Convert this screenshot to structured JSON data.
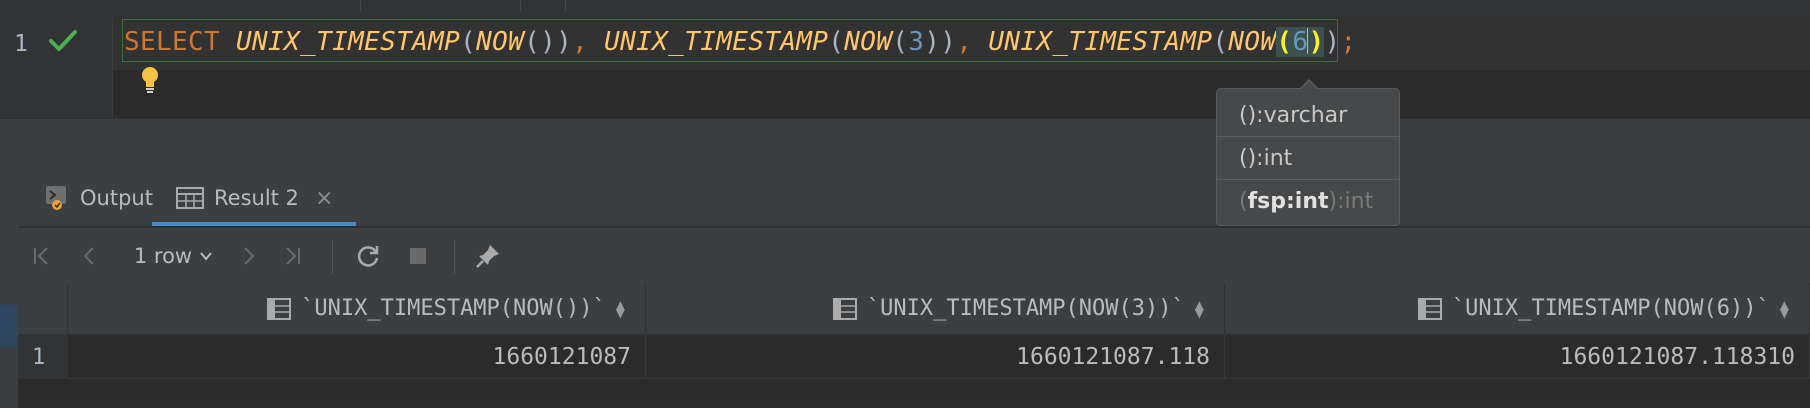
{
  "editor": {
    "line_number": "1",
    "code": {
      "kw_select": "SELECT",
      "fn": "UNIX_TIMESTAMP",
      "fn_now": "NOW",
      "arg1": "3",
      "arg2": "6",
      "semicolon": ";"
    }
  },
  "completion_popup": {
    "items": [
      {
        "label": "():varchar"
      },
      {
        "label": "():int"
      },
      {
        "open": "(",
        "param": "fsp:int",
        "close": ")",
        "ret": ":int"
      }
    ]
  },
  "tool_tabs": {
    "output_label": "Output",
    "result_label": "Result 2",
    "close_glyph": "×"
  },
  "toolbar": {
    "rows_label": "1 row"
  },
  "grid": {
    "columns": [
      "`UNIX_TIMESTAMP(NOW())`",
      "`UNIX_TIMESTAMP(NOW(3))`",
      "`UNIX_TIMESTAMP(NOW(6))`"
    ],
    "rows": [
      {
        "num": "1",
        "cells": [
          "1660121087",
          "1660121087.118",
          "1660121087.118310"
        ]
      }
    ]
  },
  "colors": {
    "keyword": "#cc7832",
    "function": "#ffc66d",
    "number": "#6897bb",
    "accent": "#4a88c7",
    "success": "#4caf50"
  }
}
